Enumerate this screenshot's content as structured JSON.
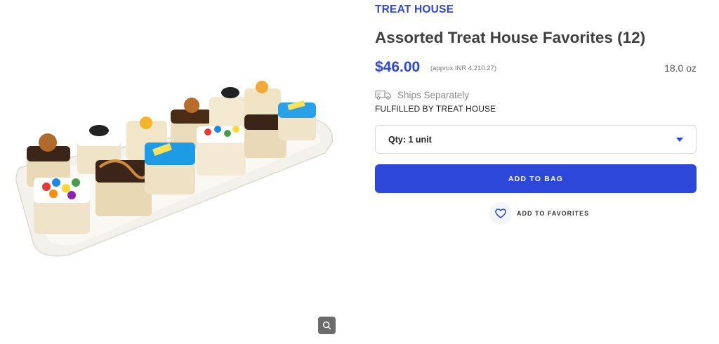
{
  "product": {
    "brand": "TREAT HOUSE",
    "title": "Assorted Treat House Favorites (12)",
    "price": "$46.00",
    "approx_price": "(approx INR 4,210.27)",
    "weight": "18.0 oz",
    "image_alt": "Assorted Treat House Favorites tray"
  },
  "shipping": {
    "ships_label": "Ships Separately",
    "fulfilled_label": "FULFILLED BY TREAT HOUSE"
  },
  "quantity": {
    "selected": "Qty: 1 unit"
  },
  "actions": {
    "add_to_bag": "ADD TO BAG",
    "add_to_favorites": "ADD TO FAVORITES"
  },
  "icons": {
    "zoom": "zoom-icon",
    "truck": "truck-icon",
    "heart": "heart-icon",
    "caret": "chevron-down-icon"
  },
  "colors": {
    "accent": "#2d47d9",
    "title": "#3f3f3f",
    "muted": "#8a8a8a"
  }
}
